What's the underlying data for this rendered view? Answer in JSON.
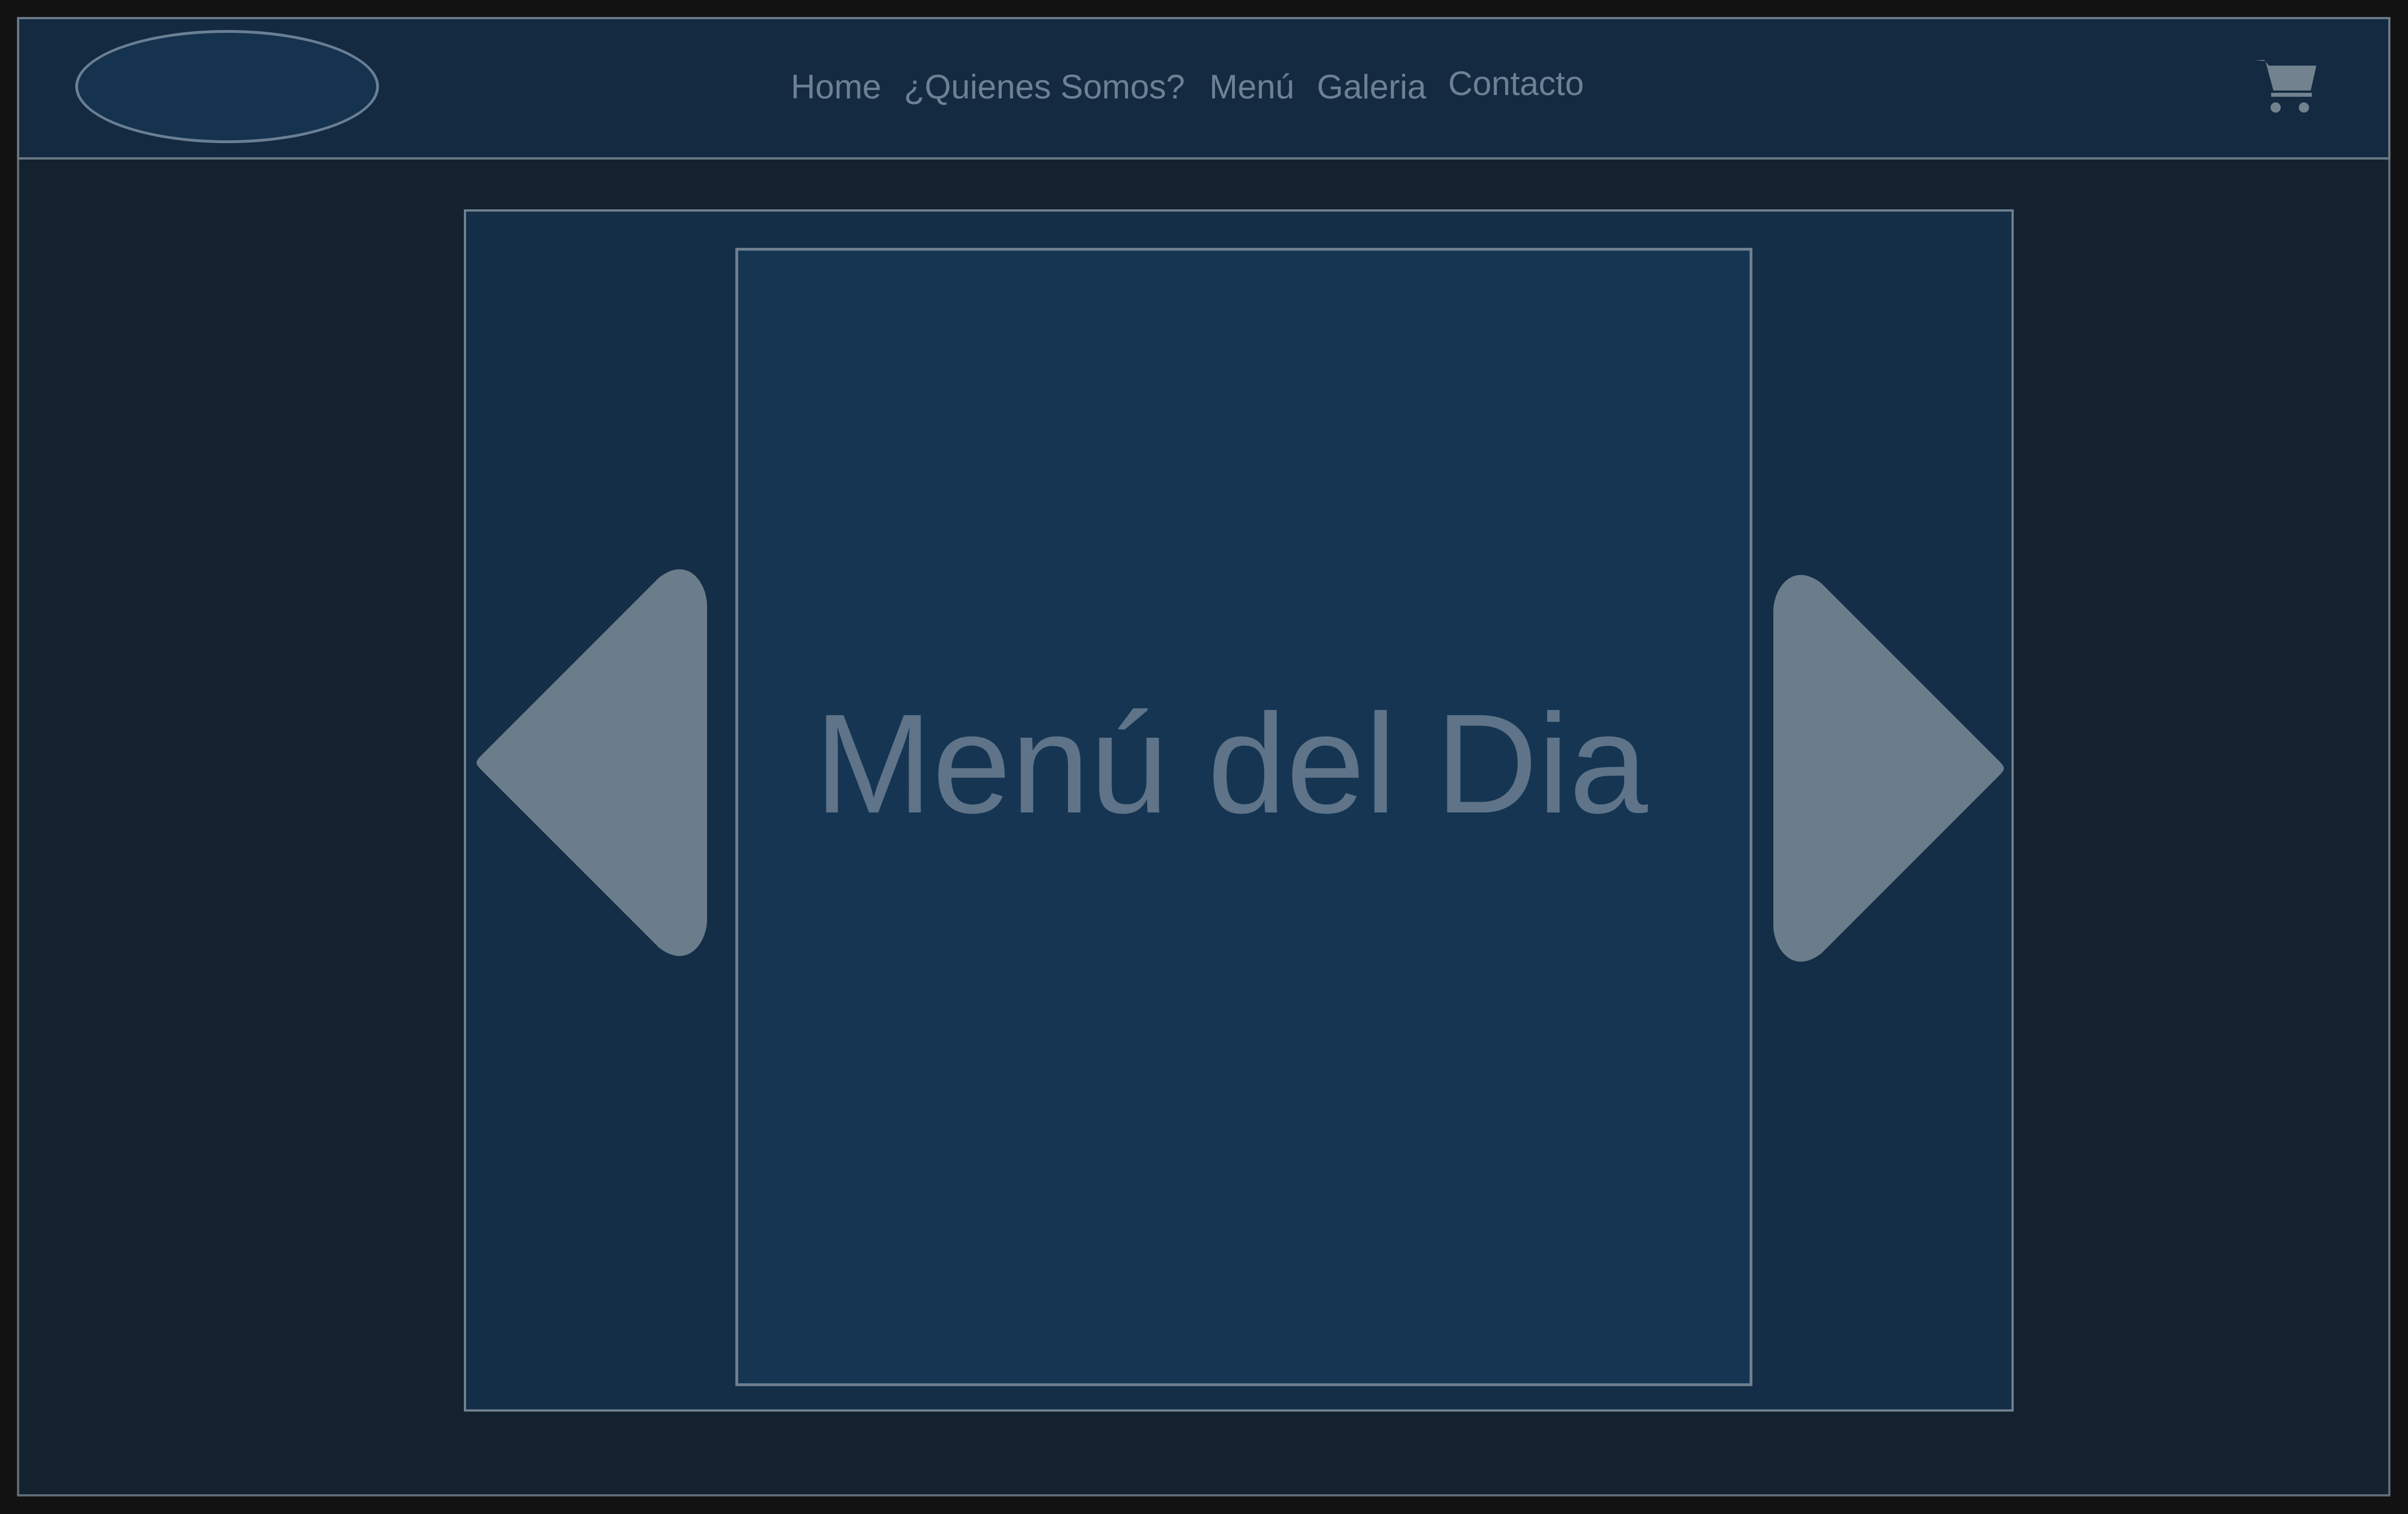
{
  "nav": {
    "logo_icon": "logo-placeholder-ellipse",
    "links": [
      "Home",
      "¿Quienes Somos?",
      "Menú",
      "Galeria",
      "Contacto"
    ],
    "cart_icon": "shopping-cart-icon"
  },
  "slider": {
    "title": "Menú del Dia",
    "prev_icon": "chevron-left-icon",
    "next_icon": "chevron-right-icon"
  },
  "colors": {
    "page_background": "#14222f",
    "navbar_background": "#142a41",
    "slider_background": "#142e47",
    "slide_background": "#153553",
    "muted_text": "#6d8193",
    "arrow_fill": "#6b7d8a",
    "border": "#6e7f8f"
  }
}
